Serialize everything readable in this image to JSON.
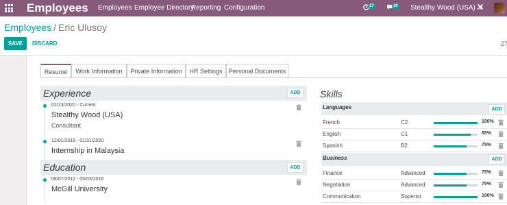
{
  "navbar": {
    "brand": "Employees",
    "menu": [
      "Employees",
      "Employee Directory",
      "Reporting",
      "Configuration"
    ],
    "activity_count": "37",
    "message_count": "30",
    "company": "Stealthy Wood (USA)"
  },
  "breadcrumb": {
    "parent": "Employees",
    "separator": "/",
    "current": "Eric Ulusoy"
  },
  "actions": {
    "save": "SAVE",
    "discard": "DISCARD"
  },
  "pager": "27",
  "tabs": [
    "Resumé",
    "Work Information",
    "Private Information",
    "HR Settings",
    "Personal Documents"
  ],
  "resume": {
    "experience_title": "Experience",
    "education_title": "Education",
    "add_label": "ADD",
    "experience": [
      {
        "date": "02/13/2020 - Current",
        "name": "Stealthy Wood (USA)",
        "desc": "Consultant"
      },
      {
        "date": "12/01/2019 - 01/31/2020",
        "name": "Internship in Malaysia",
        "desc": ""
      }
    ],
    "education": [
      {
        "date": "08/07/2012 - 05/03/2016",
        "name": "McGill University",
        "desc": ""
      }
    ]
  },
  "skills": {
    "title": "Skills",
    "add_label": "ADD",
    "groups": [
      {
        "name": "Languages",
        "items": [
          {
            "name": "French",
            "level": "C2",
            "progress": 100,
            "pct": "100%"
          },
          {
            "name": "English",
            "level": "C1",
            "progress": 85,
            "pct": "85%"
          },
          {
            "name": "Spanish",
            "level": "B2",
            "progress": 75,
            "pct": "75%"
          }
        ]
      },
      {
        "name": "Business",
        "items": [
          {
            "name": "Finance",
            "level": "Advanced",
            "progress": 75,
            "pct": "75%"
          },
          {
            "name": "Negotiation",
            "level": "Advanced",
            "progress": 75,
            "pct": "75%"
          },
          {
            "name": "Communication",
            "level": "Superior",
            "progress": 100,
            "pct": "100%"
          }
        ]
      }
    ]
  },
  "colors": {
    "navbar": "#875a7b",
    "accent": "#00a09d"
  }
}
